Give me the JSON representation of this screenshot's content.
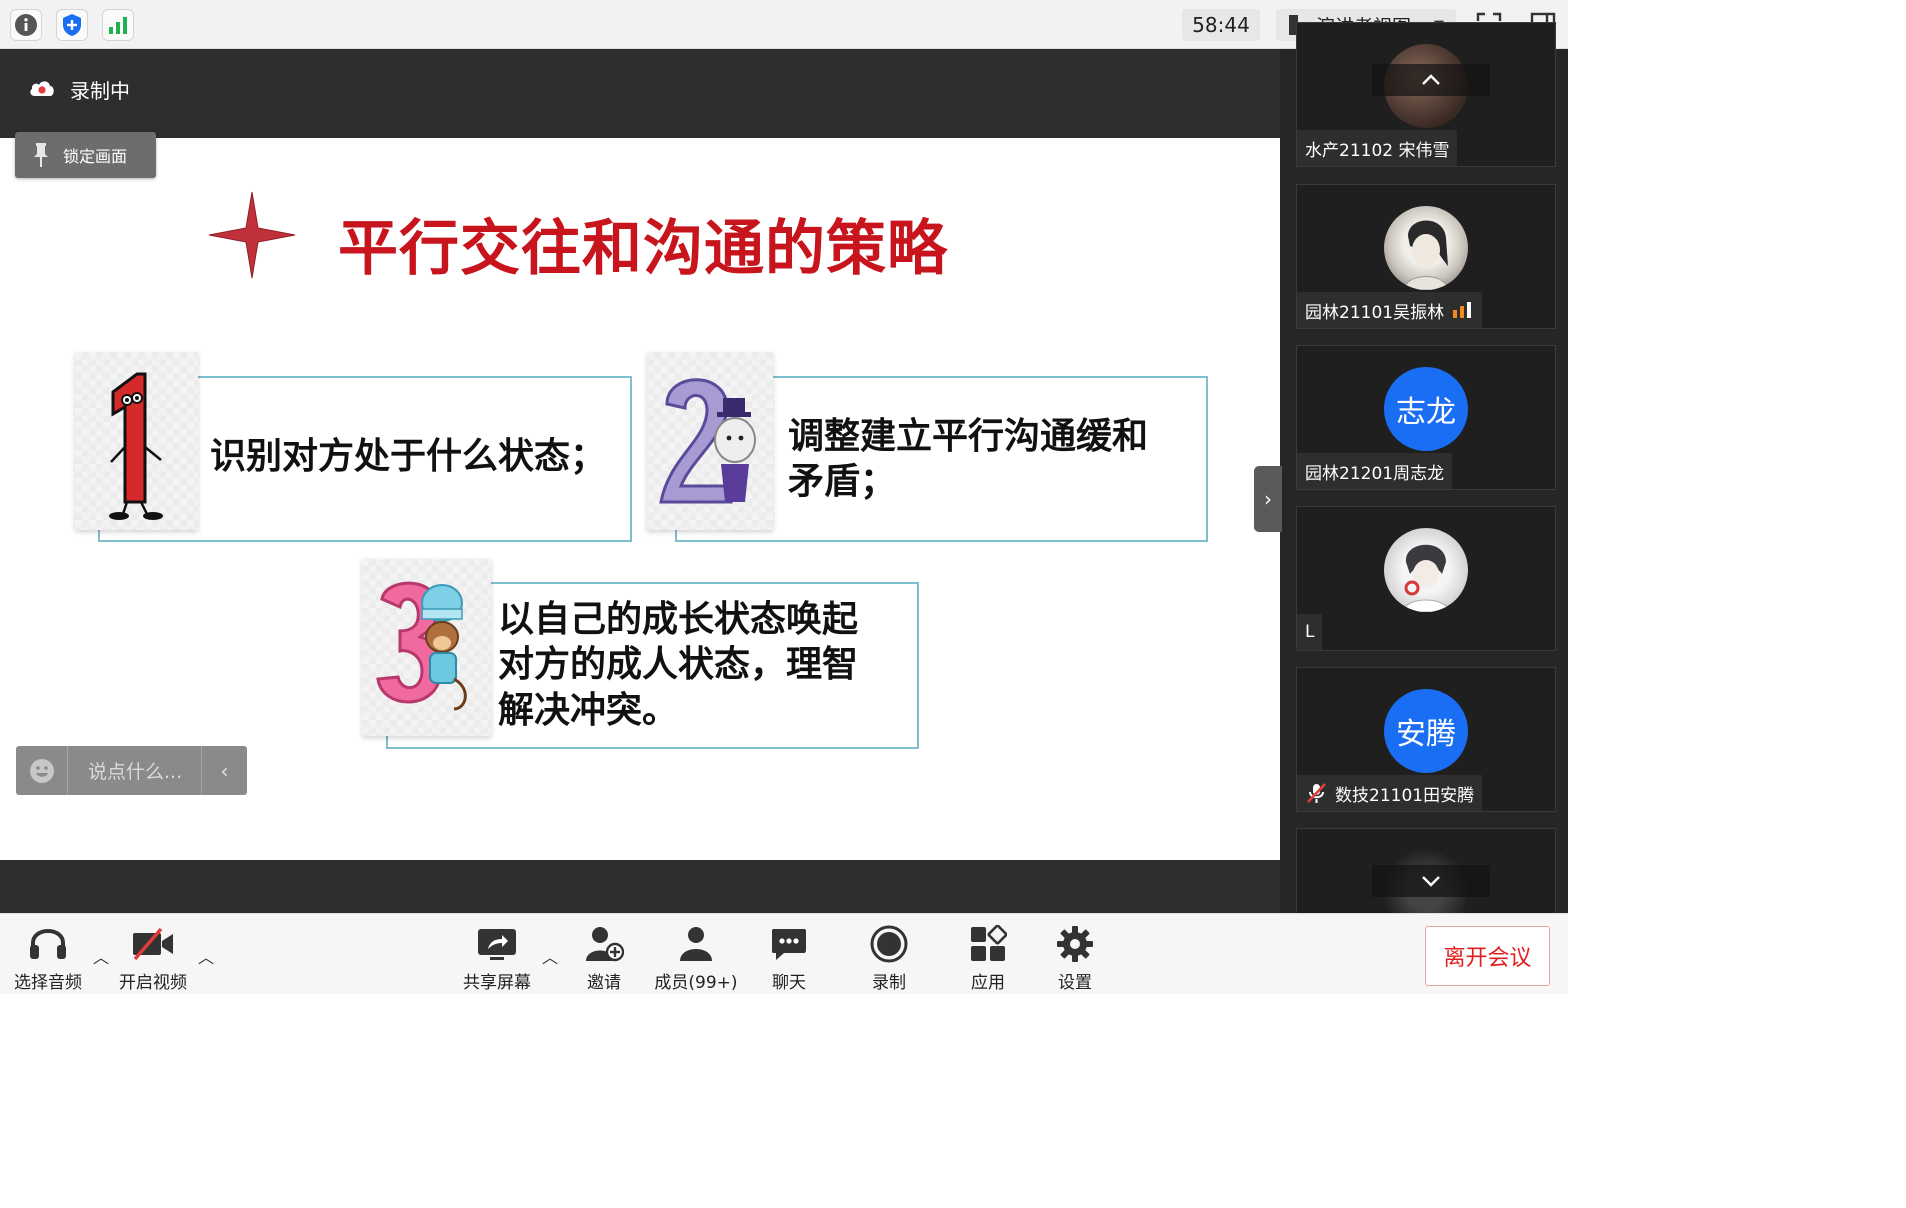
{
  "topbar": {
    "timer": "58:44",
    "view_mode": "演讲者视图",
    "icons": [
      "info-icon",
      "shield-icon",
      "signal-icon",
      "fullscreen-icon",
      "panel-icon"
    ]
  },
  "stage": {
    "recording_label": "录制中",
    "lock_label": "锁定画面",
    "chat_placeholder": "说点什么..."
  },
  "slide": {
    "title": "平行交往和沟通的策略",
    "items": [
      {
        "number": "1",
        "text": "识别对方处于什么状态；"
      },
      {
        "number": "2",
        "text_line1": "调整建立平行沟通缓和",
        "text_line2": "矛盾；"
      },
      {
        "number": "3",
        "text_line1": "以自己的成长状态唤起",
        "text_line2": "对方的成人状态，理智",
        "text_line3": "解决冲突。"
      }
    ],
    "colors": {
      "title": "#c8141d",
      "card_border": "#7fbecc",
      "star": "#c0313b"
    }
  },
  "participants": [
    {
      "name": "水产21102 宋伟雪"
    },
    {
      "name": "园林21101吴振林"
    },
    {
      "name": "园林21201周志龙",
      "avatar_text": "志龙"
    },
    {
      "name": "L"
    },
    {
      "name": "数技21101田安腾",
      "avatar_text": "安腾"
    }
  ],
  "toolbar": {
    "audio": "选择音频",
    "video": "开启视频",
    "share": "共享屏幕",
    "invite": "邀请",
    "members": "成员(99+)",
    "chat": "聊天",
    "record": "录制",
    "apps": "应用",
    "settings": "设置",
    "leave": "离开会议"
  }
}
